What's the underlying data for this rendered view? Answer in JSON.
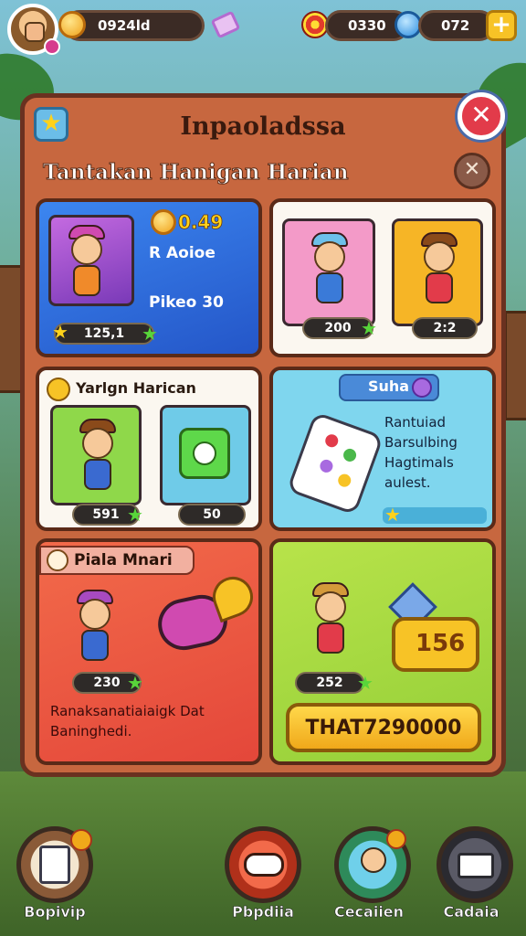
{
  "topbar": {
    "coins": "0924ld",
    "score": "0330",
    "orbs": "072",
    "plus": "+"
  },
  "panel": {
    "title": "Inpaoladssa",
    "subtitle": "Tantakan Hanigan Harian",
    "close_primary": "✕",
    "close_secondary": "✕",
    "star_badge": "★"
  },
  "cards": {
    "c1": {
      "top_value": "0.49",
      "label1": "R Aoioe",
      "label2": "Pikeo 30",
      "reward": "125,1"
    },
    "c2": {
      "reward_a": "200",
      "reward_b": "2:2"
    },
    "c3": {
      "title": "Yarlgn Harican",
      "reward_a": "591",
      "reward_b": "50"
    },
    "c4": {
      "title": "Suha",
      "desc": "Rantuiad Barsulbing Hagtimals aulest.",
      "star": "★"
    },
    "c5": {
      "title": "Piala Mnari",
      "reward": "230",
      "desc": "Ranaksanatiaiaigk Dat Baninghedi."
    },
    "c6": {
      "reward": "252",
      "badge_value": "156",
      "button": "THAT7290000"
    }
  },
  "nav": [
    {
      "label": "Bopivip",
      "icon": "quest-scroll-icon"
    },
    {
      "label": "Pbpdiia",
      "icon": "gamepad-icon"
    },
    {
      "label": "Cecaiien",
      "icon": "friend-avatar-icon"
    },
    {
      "label": "Cadaia",
      "icon": "mail-icon"
    }
  ],
  "colors": {
    "panel": "#c7673f",
    "card_blue": "#2f6ee0",
    "card_cyan": "#6fd0ea",
    "card_red": "#ee5a3e",
    "card_green": "#a8d84a",
    "gold_button": "#f7c326"
  }
}
